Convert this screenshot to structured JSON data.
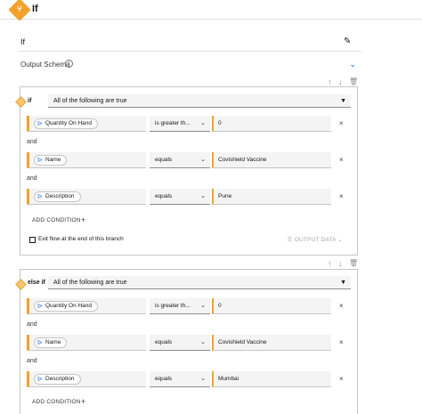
{
  "header": {
    "title": "If",
    "icon": "if-step-icon"
  },
  "step_name": {
    "value": "If",
    "edit_icon": "pencil-icon"
  },
  "output_schema": {
    "label": "Output Schema",
    "info_icon": "info-icon",
    "expand_icon": "chevron-down-icon"
  },
  "toolbar_icons": {
    "up": "↑",
    "down": "↓",
    "delete": "🗑"
  },
  "branches": [
    {
      "label": "if",
      "match": "All of the following are true",
      "conditions": [
        {
          "field": "Quantity On Hand",
          "operator": "is greater th...",
          "value": "0"
        },
        {
          "field": "Name",
          "operator": "equals",
          "value": "Covishield Vaccine"
        },
        {
          "field": "Description",
          "operator": "equals",
          "value": "Pune"
        }
      ],
      "and_label": "and",
      "add_condition": "ADD CONDITION",
      "exit_flow": "Exit flow at the end of this branch",
      "output_data": "OUTPUT DATA"
    },
    {
      "label": "else if",
      "match": "All of the following are true",
      "conditions": [
        {
          "field": "Quantity On Hand",
          "operator": "is greater th...",
          "value": "0"
        },
        {
          "field": "Name",
          "operator": "equals",
          "value": "Covishield Vaccine"
        },
        {
          "field": "Description",
          "operator": "equals",
          "value": "Mumbai"
        }
      ],
      "and_label": "and",
      "add_condition": "ADD CONDITION"
    }
  ],
  "colors": {
    "accent": "#f1a22a",
    "link": "#0f62fe",
    "field_bg": "#f4f4f4"
  }
}
